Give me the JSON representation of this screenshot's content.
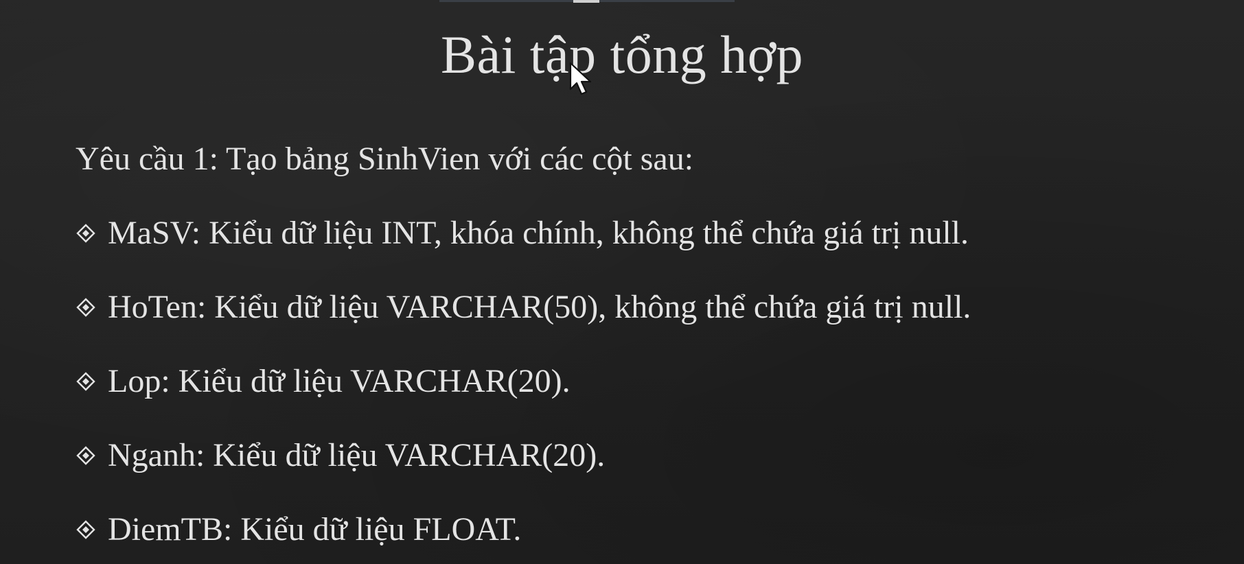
{
  "slide": {
    "title": "Bài tập tổng hợp",
    "requirement": "Yêu cầu 1: Tạo bảng SinhVien với các cột sau:",
    "bullet_icon": "diamond-bullet-icon",
    "items": [
      {
        "label": "MaSV: Kiểu dữ liệu INT, khóa chính, không thể chứa giá trị null."
      },
      {
        "label": "HoTen: Kiểu dữ liệu VARCHAR(50), không thể chứa giá trị null."
      },
      {
        "label": "Lop: Kiểu dữ liệu VARCHAR(20)."
      },
      {
        "label": "Nganh: Kiểu dữ liệu VARCHAR(20)."
      },
      {
        "label": "DiemTB: Kiểu dữ liệu FLOAT."
      }
    ]
  },
  "colors": {
    "background": "#232323",
    "text": "#e4e4e4"
  },
  "cursor_icon": "mouse-pointer-icon"
}
